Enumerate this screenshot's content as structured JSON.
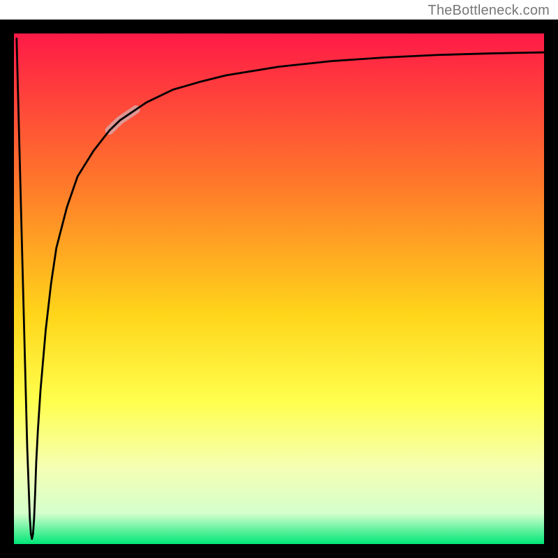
{
  "watermark": "TheBottleneck.com",
  "chart_data": {
    "type": "line",
    "title": "",
    "xlabel": "",
    "ylabel": "",
    "xlim": [
      0,
      100
    ],
    "ylim": [
      0,
      100
    ],
    "grid": false,
    "legend": false,
    "gradient_stops": [
      {
        "offset": 0,
        "color": "#ff1a47"
      },
      {
        "offset": 30,
        "color": "#ff7a2a"
      },
      {
        "offset": 55,
        "color": "#ffd51a"
      },
      {
        "offset": 72,
        "color": "#ffff4d"
      },
      {
        "offset": 85,
        "color": "#f5ffb3"
      },
      {
        "offset": 94,
        "color": "#d4ffcc"
      },
      {
        "offset": 100,
        "color": "#00e676"
      }
    ],
    "series": [
      {
        "name": "bottleneck-curve",
        "color": "#000000",
        "stroke_width": 2.8,
        "x": [
          0.5,
          1,
          1.5,
          2,
          2.5,
          3,
          3.2,
          3.4,
          3.6,
          3.8,
          4,
          4.2,
          4.5,
          5,
          6,
          7,
          8,
          10,
          12,
          15,
          18,
          20,
          25,
          30,
          35,
          40,
          50,
          60,
          70,
          80,
          90,
          100
        ],
        "y": [
          99,
          79,
          59,
          39,
          19,
          5,
          2,
          1,
          2,
          5,
          10,
          16,
          22,
          30,
          42,
          51,
          58,
          66,
          72,
          77,
          81,
          83,
          86.5,
          89,
          90.5,
          91.8,
          93.5,
          94.6,
          95.3,
          95.8,
          96.1,
          96.3
        ]
      }
    ],
    "highlight_segment": {
      "x_start": 18,
      "x_end": 23,
      "color": "#d9a3a3",
      "stroke_width": 12
    }
  }
}
